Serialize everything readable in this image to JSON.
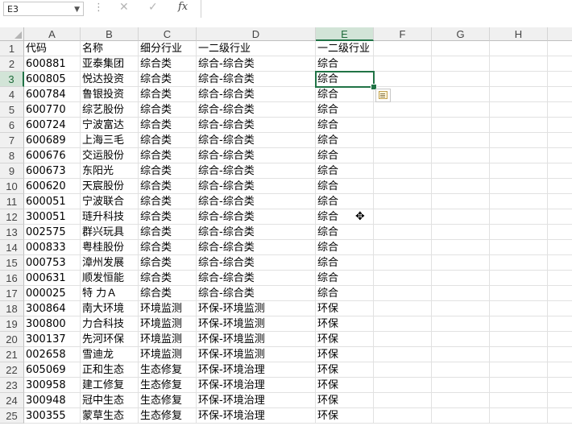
{
  "formula_bar": {
    "name_box": "E3",
    "cancel_icon": "✕",
    "enter_icon": "✓",
    "fx_label": "fx",
    "formula_value": ""
  },
  "columns": [
    "A",
    "B",
    "C",
    "D",
    "E",
    "F",
    "G",
    "H"
  ],
  "selected_column": "E",
  "selected_row": "3",
  "row_numbers": [
    "1",
    "2",
    "3",
    "4",
    "5",
    "6",
    "7",
    "8",
    "9",
    "10",
    "11",
    "12",
    "13",
    "14",
    "15",
    "16",
    "17",
    "18",
    "19",
    "20",
    "21",
    "22",
    "23",
    "24",
    "25"
  ],
  "rows": [
    [
      "代码",
      "名称",
      "细分行业",
      "一二级行业",
      "一二级行业"
    ],
    [
      "600881",
      "亚泰集团",
      "综合类",
      "综合-综合类",
      "综合"
    ],
    [
      "600805",
      "悦达投资",
      "综合类",
      "综合-综合类",
      "综合"
    ],
    [
      "600784",
      "鲁银投资",
      "综合类",
      "综合-综合类",
      "综合"
    ],
    [
      "600770",
      "综艺股份",
      "综合类",
      "综合-综合类",
      "综合"
    ],
    [
      "600724",
      "宁波富达",
      "综合类",
      "综合-综合类",
      "综合"
    ],
    [
      "600689",
      "上海三毛",
      "综合类",
      "综合-综合类",
      "综合"
    ],
    [
      "600676",
      "交运股份",
      "综合类",
      "综合-综合类",
      "综合"
    ],
    [
      "600673",
      "东阳光",
      "综合类",
      "综合-综合类",
      "综合"
    ],
    [
      "600620",
      "天宸股份",
      "综合类",
      "综合-综合类",
      "综合"
    ],
    [
      "600051",
      "宁波联合",
      "综合类",
      "综合-综合类",
      "综合"
    ],
    [
      "300051",
      "琏升科技",
      "综合类",
      "综合-综合类",
      "综合"
    ],
    [
      "002575",
      "群兴玩具",
      "综合类",
      "综合-综合类",
      "综合"
    ],
    [
      "000833",
      "粤桂股份",
      "综合类",
      "综合-综合类",
      "综合"
    ],
    [
      "000753",
      "漳州发展",
      "综合类",
      "综合-综合类",
      "综合"
    ],
    [
      "000631",
      "顺发恒能",
      "综合类",
      "综合-综合类",
      "综合"
    ],
    [
      "000025",
      "特 力Ａ",
      "综合类",
      "综合-综合类",
      "综合"
    ],
    [
      "300864",
      "南大环境",
      "环境监测",
      "环保-环境监测",
      "环保"
    ],
    [
      "300800",
      "力合科技",
      "环境监测",
      "环保-环境监测",
      "环保"
    ],
    [
      "300137",
      "先河环保",
      "环境监测",
      "环保-环境监测",
      "环保"
    ],
    [
      "002658",
      "雪迪龙",
      "环境监测",
      "环保-环境监测",
      "环保"
    ],
    [
      "605069",
      "正和生态",
      "生态修复",
      "环保-环境治理",
      "环保"
    ],
    [
      "300958",
      "建工修复",
      "生态修复",
      "环保-环境治理",
      "环保"
    ],
    [
      "300948",
      "冠中生态",
      "生态修复",
      "环保-环境治理",
      "环保"
    ],
    [
      "300355",
      "蒙草生态",
      "生态修复",
      "环保-环境治理",
      "环保"
    ]
  ],
  "icons": {
    "paste_options": "paste-options-icon",
    "cursor": "cross-cursor-icon"
  },
  "colors": {
    "accent": "#217346",
    "header_bg": "#f0f0f0",
    "selected_header_bg": "#d2e4d7"
  }
}
